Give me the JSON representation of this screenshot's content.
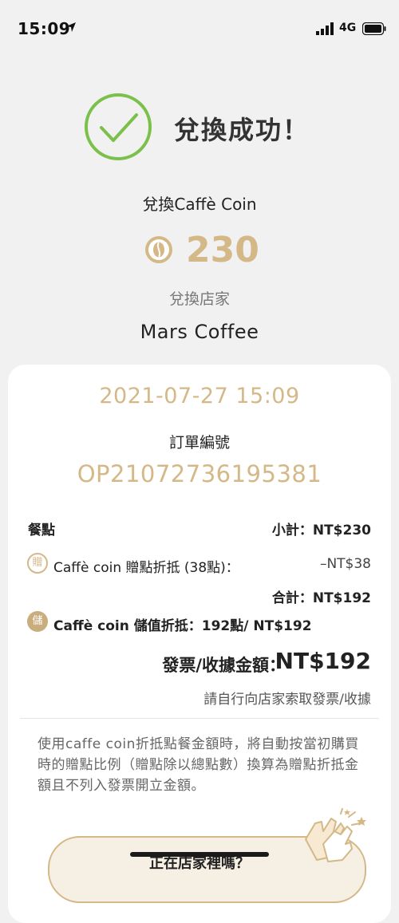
{
  "status_bar": {
    "time": "15:09",
    "network": "4G"
  },
  "success": {
    "title": "兌換成功！"
  },
  "exchange": {
    "label": "兌換Caffè Coin",
    "amount": "230",
    "store_label": "兌換店家",
    "store_name": "Mars Coffee"
  },
  "receipt": {
    "datetime": "2021-07-27 15:09",
    "order_label": "訂單編號",
    "order_number": "OP21072736195381",
    "items_label": "餐點",
    "subtotal": "小計：NT$230",
    "bonus_badge": "贈",
    "bonus_label": "Caffè coin 贈點折抵 (38點)：",
    "bonus_value": "–NT$38",
    "total": "合計：NT$192",
    "stored_badge": "儲",
    "stored_label": "Caffè coin 儲值折抵：192點/ NT$192",
    "invoice_label": "發票/收據金額：",
    "invoice_amount": "NT$192",
    "invoice_note": "請自行向店家索取發票/收據",
    "paragraph": "使用caffe coin折抵點餐金額時，將自動按當初購買時的贈點比例（贈點除以總點數）換算為贈點折抵金額且不列入發票開立金額。"
  },
  "bottom": {
    "prompt": "正在店家裡嗎？"
  },
  "colors": {
    "accent": "#d4b887",
    "success_green": "#7bc04a"
  }
}
